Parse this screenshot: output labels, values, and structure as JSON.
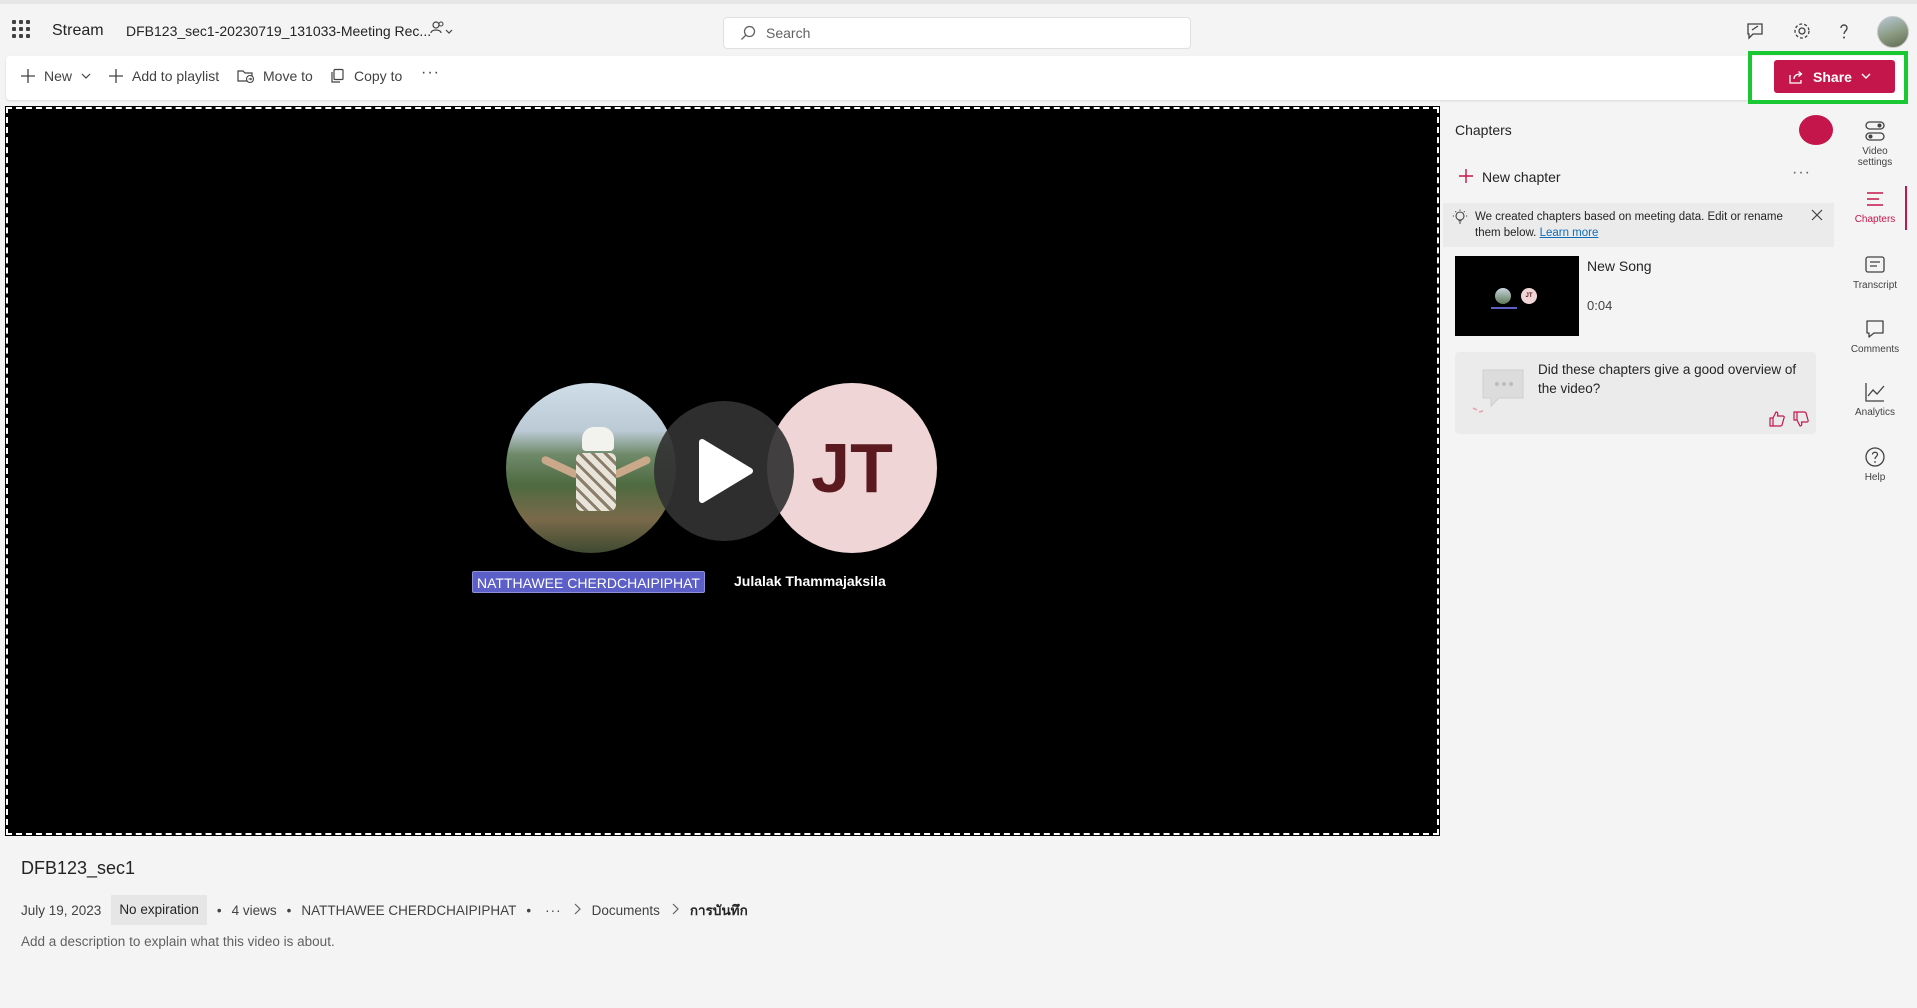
{
  "header": {
    "app_name": "Stream",
    "doc_title": "DFB123_sec1-20230719_131033-Meeting Rec...",
    "search_placeholder": "Search"
  },
  "toolbar": {
    "new_label": "New",
    "add_to_playlist_label": "Add to playlist",
    "move_to_label": "Move to",
    "copy_to_label": "Copy to",
    "more_label": "···",
    "share_label": "Share"
  },
  "video": {
    "participants": [
      {
        "name": "NATTHAWEE CHERDCHAIPIPHAT"
      },
      {
        "name": "Julalak Thammajaksila",
        "initials": "JT"
      }
    ]
  },
  "chapters": {
    "title": "Chapters",
    "new_chapter_label": "New chapter",
    "more_label": "···",
    "banner_text": "We created chapters based on meeting data. Edit or rename them below.",
    "banner_link": "Learn more",
    "items": [
      {
        "name": "New Song",
        "time": "0:04",
        "thumb_initials": "JT"
      }
    ],
    "feedback_question": "Did these chapters give a good overview of the video?"
  },
  "rail": {
    "video_settings": "Video settings",
    "chapters": "Chapters",
    "transcript": "Transcript",
    "comments": "Comments",
    "analytics": "Analytics",
    "help": "Help"
  },
  "details": {
    "title": "DFB123_sec1",
    "date": "July 19, 2023",
    "expiration": "No expiration",
    "views": "4 views",
    "owner": "NATTHAWEE CHERDCHAIPIPHAT",
    "more": "···",
    "breadcrumb_1": "Documents",
    "breadcrumb_2": "การบันทึก",
    "description_placeholder": "Add a description to explain what this video is about."
  },
  "colors": {
    "accent": "#c4164a",
    "highlight": "#19c832",
    "name_tag": "#5b5fc7"
  }
}
